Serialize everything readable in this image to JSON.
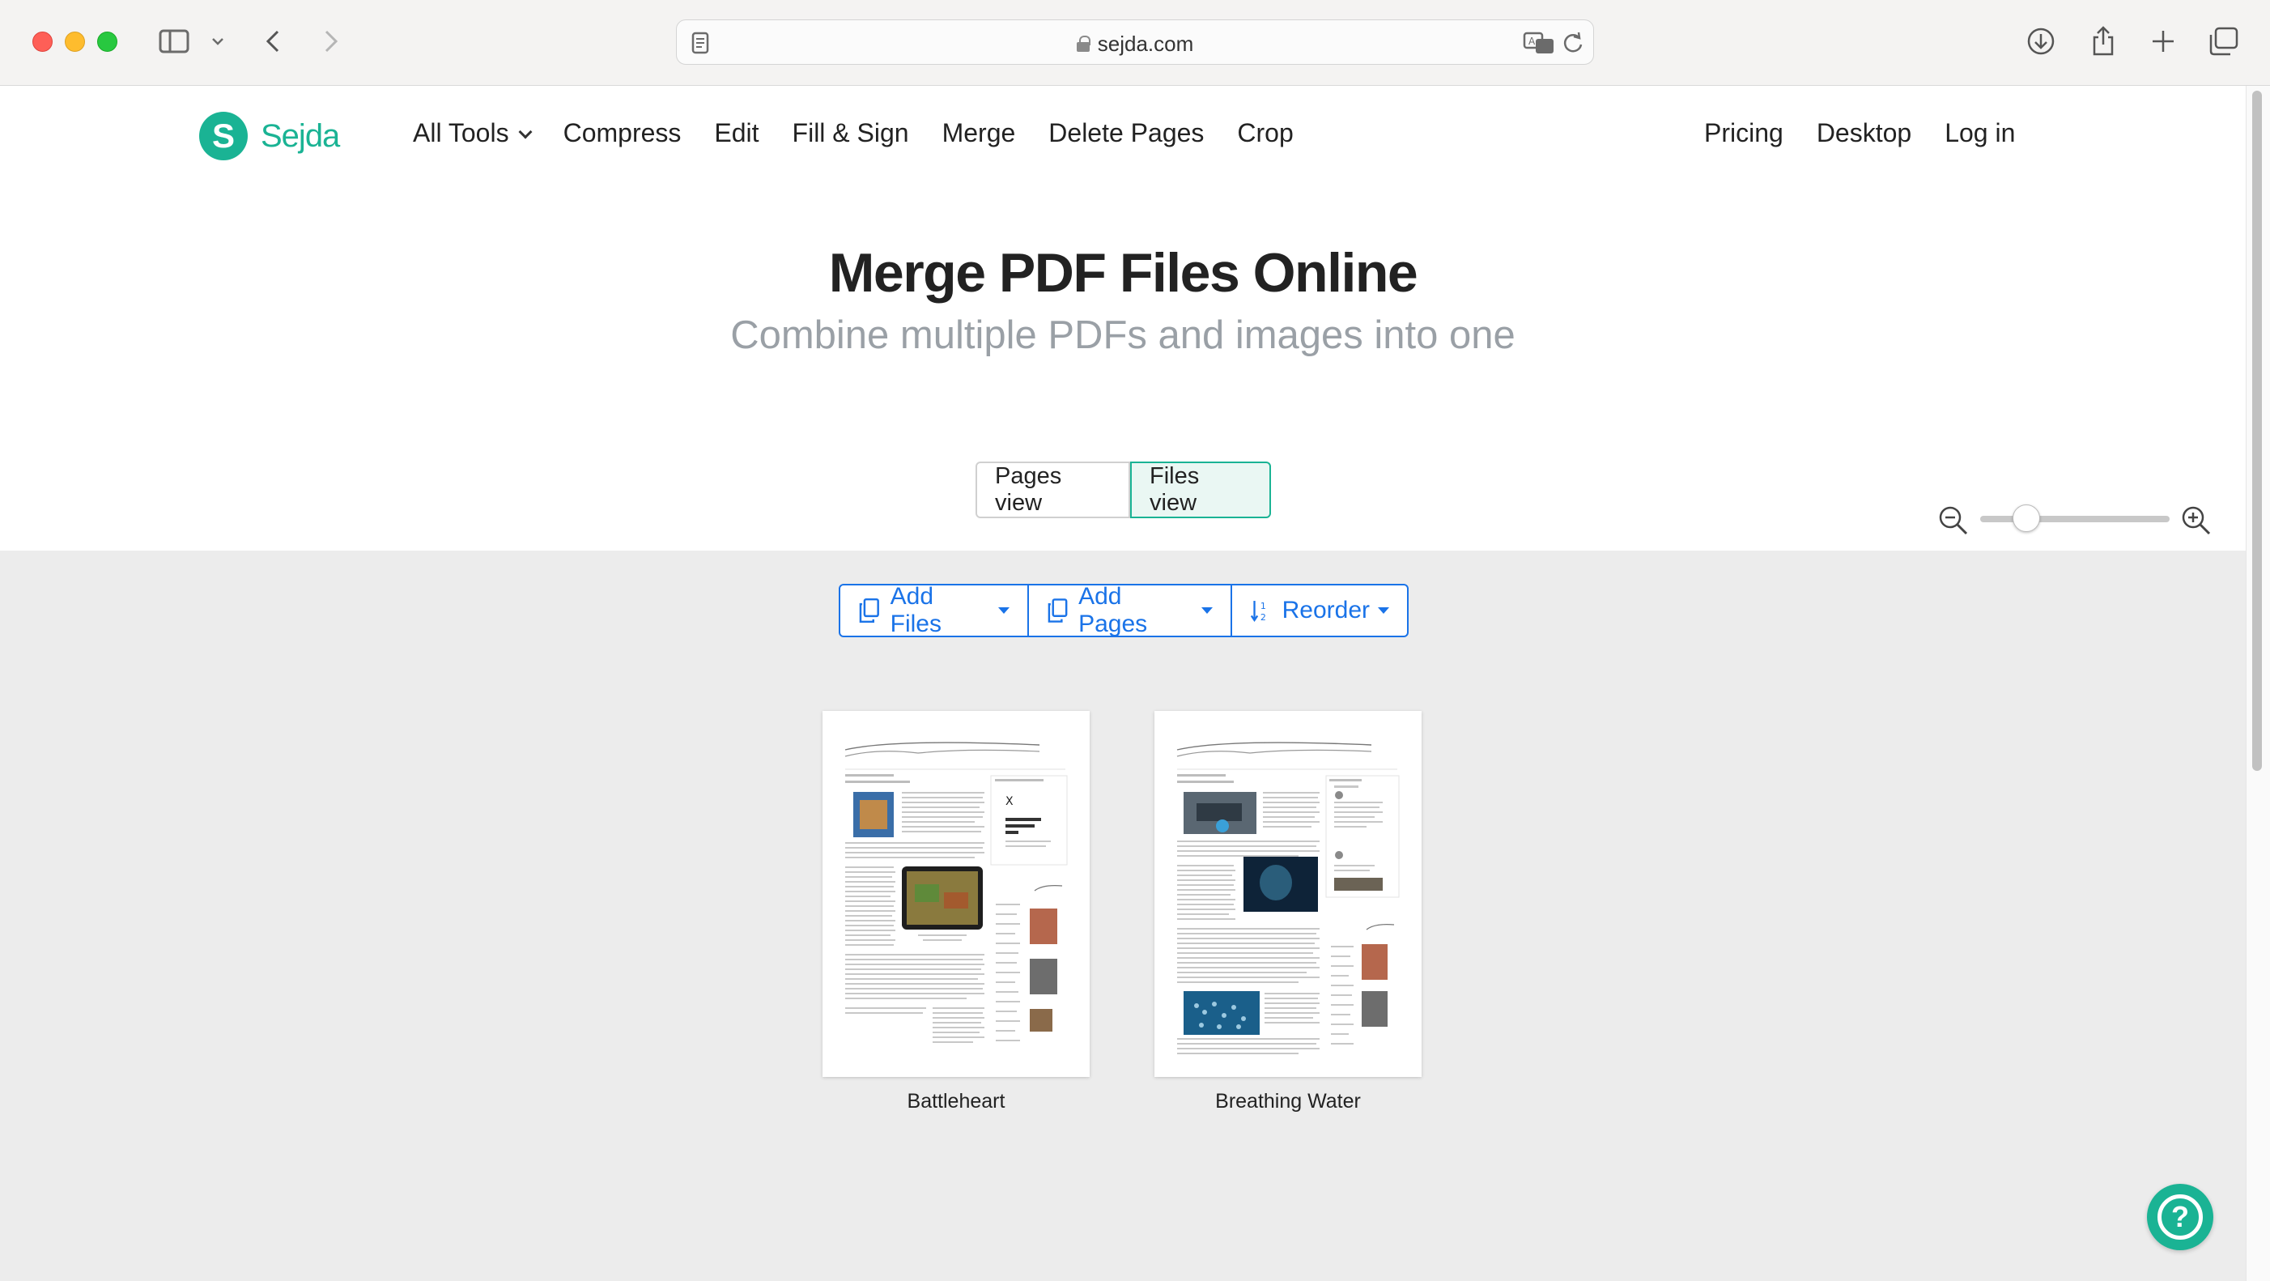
{
  "browser": {
    "url": "sejda.com",
    "icons": [
      "sidebar-icon",
      "back-icon",
      "forward-icon",
      "reader-icon",
      "translate-icon",
      "reload-icon",
      "download-icon",
      "share-icon",
      "new-tab-icon",
      "tab-overview-icon"
    ]
  },
  "site": {
    "logo_letter": "S",
    "logo_text": "Sejda",
    "brand_color": "#1ab394"
  },
  "nav": {
    "all_tools": "All Tools",
    "left": [
      "Compress",
      "Edit",
      "Fill & Sign",
      "Merge",
      "Delete Pages",
      "Crop"
    ],
    "right": [
      "Pricing",
      "Desktop",
      "Log in"
    ]
  },
  "hero": {
    "title": "Merge PDF Files Online",
    "subtitle": "Combine multiple PDFs and images into one"
  },
  "view_toggle": {
    "pages": "Pages view",
    "files": "Files view",
    "selected": "files"
  },
  "zoom": {
    "icons": [
      "zoom-out-icon",
      "zoom-in-icon"
    ],
    "level": 0.2
  },
  "toolbar": {
    "add_files": "Add Files",
    "add_pages": "Add Pages",
    "reorder": "Reorder",
    "accent": "#1a73e8"
  },
  "files": [
    {
      "name": "Battleheart"
    },
    {
      "name": "Breathing Water"
    }
  ],
  "help": {
    "label": "?"
  }
}
